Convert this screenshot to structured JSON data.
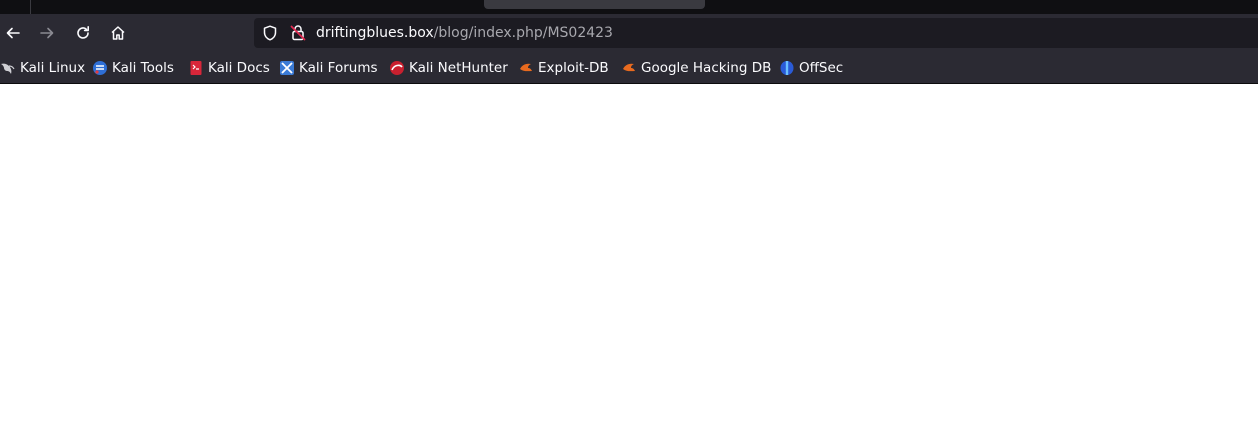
{
  "address_bar": {
    "host": "driftingblues.box",
    "path": "/blog/index.php/MS02423"
  },
  "bookmarks": [
    {
      "label": "Kali Linux",
      "icon": "kali-dragon-icon"
    },
    {
      "label": "Kali Tools",
      "icon": "kali-tools-icon"
    },
    {
      "label": "Kali Docs",
      "icon": "kali-docs-icon"
    },
    {
      "label": "Kali Forums",
      "icon": "kali-forums-icon"
    },
    {
      "label": "Kali NetHunter",
      "icon": "kali-nethunter-icon"
    },
    {
      "label": "Exploit-DB",
      "icon": "exploit-db-icon"
    },
    {
      "label": "Google Hacking DB",
      "icon": "exploit-db-icon"
    },
    {
      "label": "OffSec",
      "icon": "offsec-icon"
    }
  ],
  "colors": {
    "toolbar_bg": "#2b2a33",
    "urlbar_bg": "#1c1b22",
    "tabstrip_bg": "#0f0f12",
    "page_bg": "#ffffff",
    "insecure_lock": "#e22850"
  }
}
